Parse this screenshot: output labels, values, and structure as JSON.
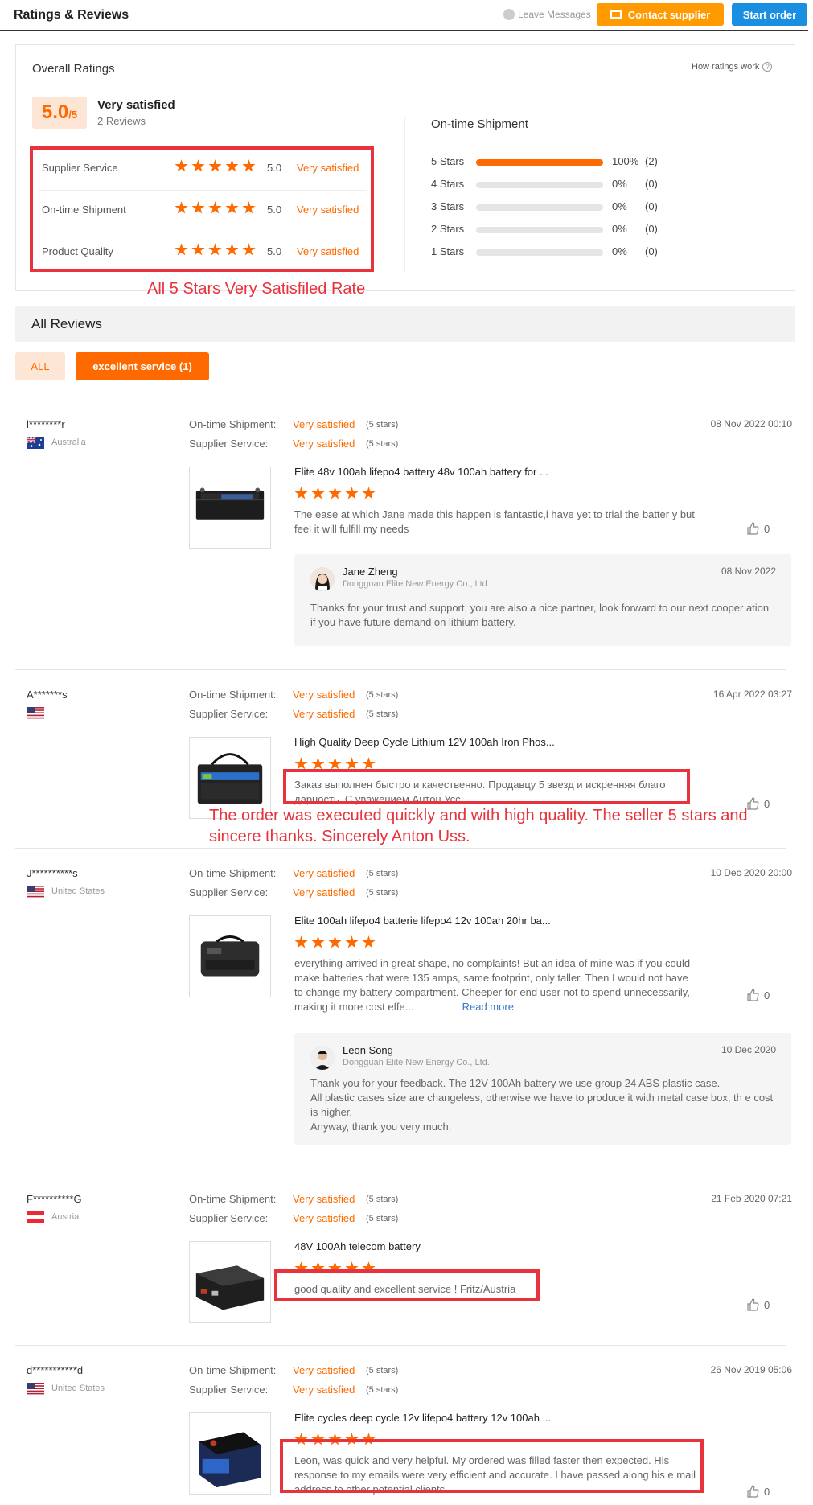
{
  "header": {
    "title": "Ratings & Reviews",
    "leave_messages": "Leave Messages",
    "contact_supplier": "Contact supplier",
    "start_order": "Start order"
  },
  "overall": {
    "title": "Overall Ratings",
    "how_link": "How ratings work",
    "score": "5.0",
    "score_suffix": "/5",
    "verdict": "Very satisfied",
    "reviews_count": "2 Reviews",
    "rows": [
      {
        "label": "Supplier Service",
        "value": "5.0",
        "verdict": "Very satisfied",
        "stars": 5
      },
      {
        "label": "On-time Shipment",
        "value": "5.0",
        "verdict": "Very satisfied",
        "stars": 5
      },
      {
        "label": "Product Quality",
        "value": "5.0",
        "verdict": "Very satisfied",
        "stars": 5
      }
    ],
    "shipment_title": "On-time Shipment",
    "distribution": [
      {
        "label": "5 Stars",
        "percent": "100%",
        "count": "(2)",
        "fraction": 1.0
      },
      {
        "label": "4 Stars",
        "percent": "0%",
        "count": "(0)",
        "fraction": 0
      },
      {
        "label": "3 Stars",
        "percent": "0%",
        "count": "(0)",
        "fraction": 0
      },
      {
        "label": "2 Stars",
        "percent": "0%",
        "count": "(0)",
        "fraction": 0
      },
      {
        "label": "1 Stars",
        "percent": "0%",
        "count": "(0)",
        "fraction": 0
      }
    ]
  },
  "annotation_1": "All 5 Stars Very Satisfiled Rate",
  "all_reviews": {
    "title": "All Reviews",
    "filter_all": "ALL",
    "filter_tag": "excellent service (1)"
  },
  "labels": {
    "shipment": "On-time Shipment:",
    "service": "Supplier Service:",
    "very_satisfied": "Very satisfied",
    "five_stars": "(5 stars)"
  },
  "reviews": [
    {
      "user": "l********r",
      "country": "Australia",
      "date": "08 Nov 2022 00:10",
      "product": "Elite 48v 100ah lifepo4 battery 48v 100ah battery for ...",
      "text": "The ease at which Jane made this happen is fantastic,i have yet to trial the batter y but feel it will fulfill my needs",
      "likes": "0",
      "reply": {
        "name": "Jane Zheng",
        "company": "Dongguan Elite New Energy Co., Ltd.",
        "date": "08 Nov 2022",
        "text": "Thanks for your trust and support, you are also a nice partner, look forward to our next cooper ation if you have future demand on lithium battery."
      }
    },
    {
      "user": "A*******s",
      "country": "",
      "date": "16 Apr 2022 03:27",
      "product": "High Quality Deep Cycle Lithium 12V 100ah Iron Phos...",
      "text": "Заказ выполнен быстро и качественно. Продавцу 5 звезд и искренняя благо дарность. С уважением Антон Усс.",
      "likes": "0"
    },
    {
      "user": "J**********s",
      "country": "United States",
      "date": "10 Dec 2020 20:00",
      "product": "Elite 100ah lifepo4 batterie lifepo4 12v 100ah 20hr ba...",
      "text": "everything arrived in great shape, no complaints! But an idea of mine was if you could make batteries that were 135 amps, same footprint, only taller. Then I would not have to change my battery compartment. Cheeper for end user not to spend unnecessarily, making it more cost effe...",
      "read_more": "Read more",
      "likes": "0",
      "reply": {
        "name": "Leon Song",
        "company": "Dongguan Elite New Energy Co., Ltd.",
        "date": "10 Dec 2020",
        "lines": [
          "Thank you for your feedback.   The 12V 100Ah battery we use group 24  ABS plastic case.",
          "All plastic cases size are changeless,  otherwise we have to produce it with metal case box, th e cost is higher.",
          "Anyway, thank you very much."
        ]
      }
    },
    {
      "user": "F**********G",
      "country": "Austria",
      "date": "21 Feb 2020 07:21",
      "product": "48V 100Ah telecom battery",
      "text": "good quality and excellent service ! Fritz/Austria",
      "likes": "0"
    },
    {
      "user": "d***********d",
      "country": "United States",
      "date": "26 Nov 2019 05:06",
      "product": "Elite cycles deep cycle 12v lifepo4 battery 12v 100ah ...",
      "text": "Leon, was quick and very helpful. My ordered was filled faster then expected. His response to my emails were very efficient and accurate. I have passed along his e mail address to other potential clients",
      "likes": "0"
    }
  ],
  "annotation_2": "The order was executed quickly and with high quality. The seller 5 stars and sincere thanks. Sincerely Anton Uss."
}
